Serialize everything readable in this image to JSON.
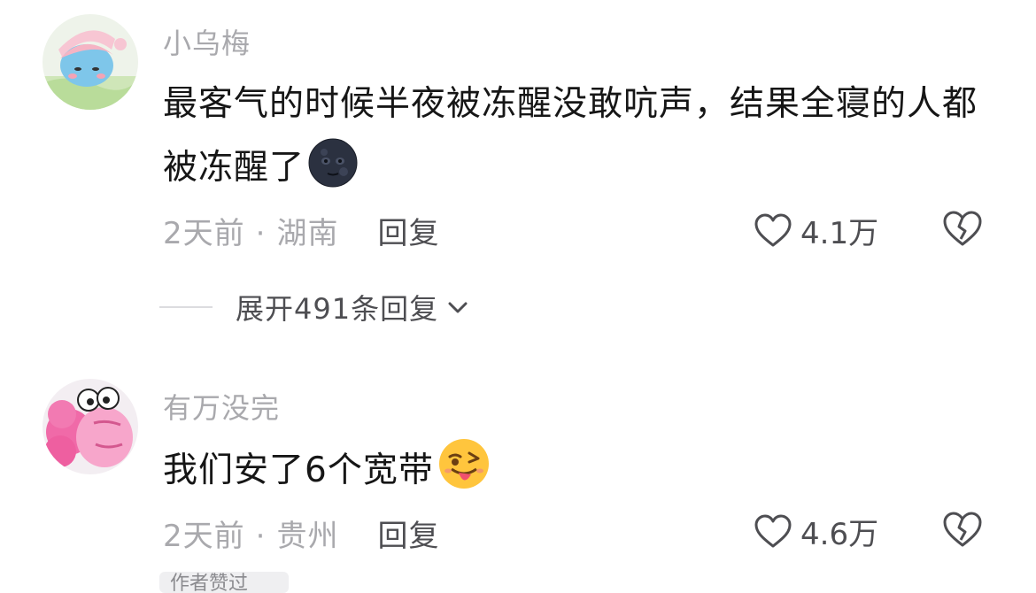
{
  "comments": [
    {
      "username": "小乌梅",
      "content": "最客气的时候半夜被冻醒没敢吭声，结果全寝的人都被冻醒了",
      "emoji_icon": "new-moon-face-emoji",
      "time": "2天前",
      "separator": "·",
      "location": "湖南",
      "reply_label": "回复",
      "likes": "4.1万",
      "expand_text": "展开491条回复"
    },
    {
      "username": "有万没完",
      "content": "我们安了6个宽带",
      "emoji_icon": "winking-face-with-tongue-emoji",
      "time": "2天前",
      "separator": "·",
      "location": "贵州",
      "reply_label": "回复",
      "likes": "4.6万",
      "tag_text": "作者赞过"
    }
  ],
  "icons": {
    "like": "heart-outline-icon",
    "dislike": "broken-heart-icon",
    "expand": "chevron-down-icon"
  },
  "colors": {
    "text_primary": "#161616",
    "text_secondary": "#a9a9ad",
    "text_action": "#4e4e52"
  }
}
